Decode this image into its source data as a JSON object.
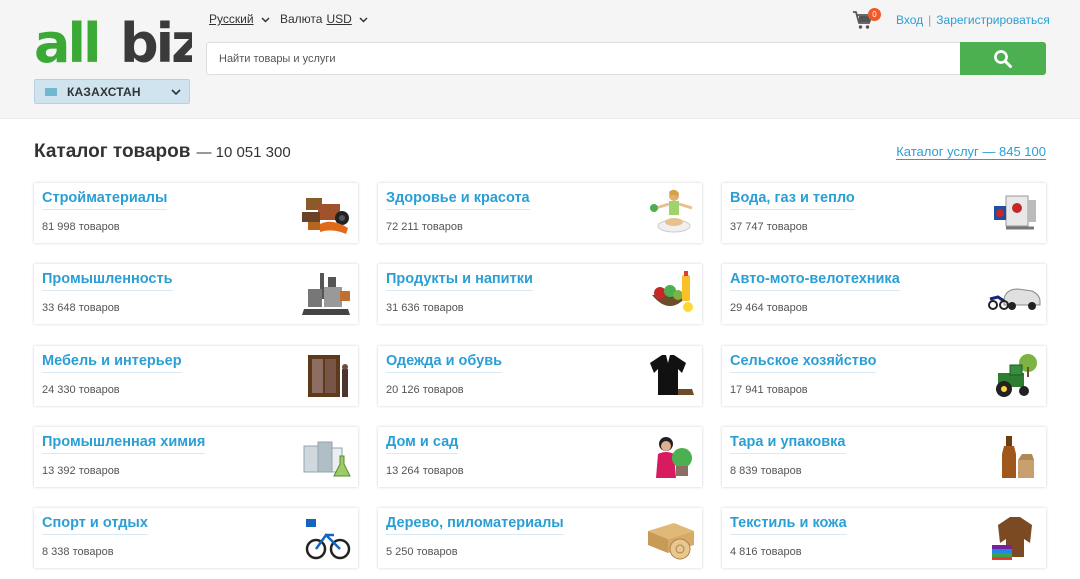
{
  "header": {
    "logo_text": "allbiz",
    "country": "КАЗАХСТАН",
    "language": "Русский",
    "currency_label": "Валюта",
    "currency_value": "USD",
    "cart_count": "0",
    "login": "Вход",
    "auth_separator": "|",
    "register": "Зарегистрироваться",
    "search_placeholder": "Найти товары и услуги",
    "colors": {
      "brand_green": "#4caf50",
      "link_blue": "#2a9fd6",
      "badge_orange": "#f05a28"
    }
  },
  "catalog": {
    "title": "Каталог товаров",
    "count": "— 10 051 300",
    "services_link": "Каталог услуг — 845 100",
    "categories": [
      {
        "name": "Стройматериалы",
        "count": "81 998 товаров",
        "icon": "building-materials-icon"
      },
      {
        "name": "Здоровье и красота",
        "count": "72 211 товаров",
        "icon": "health-beauty-icon"
      },
      {
        "name": "Вода, газ и тепло",
        "count": "37 747 товаров",
        "icon": "water-gas-heat-icon"
      },
      {
        "name": "Промышленность",
        "count": "33 648 товаров",
        "icon": "industry-icon"
      },
      {
        "name": "Продукты и напитки",
        "count": "31 636 товаров",
        "icon": "food-drinks-icon"
      },
      {
        "name": "Авто-мото-велотехника",
        "count": "29 464 товаров",
        "icon": "vehicles-icon"
      },
      {
        "name": "Мебель и интерьер",
        "count": "24 330 товаров",
        "icon": "furniture-icon"
      },
      {
        "name": "Одежда и обувь",
        "count": "20 126 товаров",
        "icon": "clothing-icon"
      },
      {
        "name": "Сельское хозяйство",
        "count": "17 941 товаров",
        "icon": "agriculture-icon"
      },
      {
        "name": "Промышленная химия",
        "count": "13 392 товаров",
        "icon": "industrial-chemistry-icon"
      },
      {
        "name": "Дом и сад",
        "count": "13 264 товаров",
        "icon": "home-garden-icon"
      },
      {
        "name": "Тара и упаковка",
        "count": "8 839 товаров",
        "icon": "packaging-icon"
      },
      {
        "name": "Спорт и отдых",
        "count": "8 338 товаров",
        "icon": "sport-icon"
      },
      {
        "name": "Дерево, пиломатериалы",
        "count": "5 250 товаров",
        "icon": "lumber-icon"
      },
      {
        "name": "Текстиль и кожа",
        "count": "4 816 товаров",
        "icon": "textile-leather-icon"
      }
    ]
  }
}
